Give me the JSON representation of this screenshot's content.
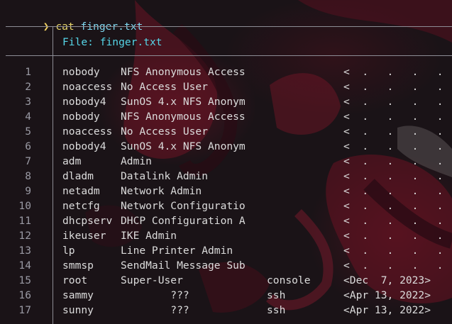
{
  "prompt": {
    "arrow": "❯",
    "command": "cat",
    "argument": "finger.txt"
  },
  "file_header": "File: finger.txt",
  "rows": [
    {
      "line": "1",
      "user": "nobody",
      "name": "NFS Anonymous Access",
      "tty": "",
      "since": "<  .   .   .   .   . >"
    },
    {
      "line": "2",
      "user": "noaccess",
      "name": "No Access User",
      "tty": "",
      "since": "<  .   .   .   .   . >"
    },
    {
      "line": "3",
      "user": "nobody4",
      "name": "SunOS 4.x NFS Anonym",
      "tty": "",
      "since": "<  .   .   .   .   . >"
    },
    {
      "line": "4",
      "user": "nobody",
      "name": "NFS Anonymous Access",
      "tty": "",
      "since": "<  .   .   .   .   . >"
    },
    {
      "line": "5",
      "user": "noaccess",
      "name": "No Access User",
      "tty": "",
      "since": "<  .   .   .   .   . >"
    },
    {
      "line": "6",
      "user": "nobody4",
      "name": "SunOS 4.x NFS Anonym",
      "tty": "",
      "since": "<  .   .   .   .   . >"
    },
    {
      "line": "7",
      "user": "adm",
      "name": "Admin",
      "tty": "",
      "since": "<  .   .   .   .   . >"
    },
    {
      "line": "8",
      "user": "dladm",
      "name": "Datalink Admin",
      "tty": "",
      "since": "<  .   .   .   .   . >"
    },
    {
      "line": "9",
      "user": "netadm",
      "name": "Network Admin",
      "tty": "",
      "since": "<  .   .   .   .   . >"
    },
    {
      "line": "10",
      "user": "netcfg",
      "name": "Network Configuratio",
      "tty": "",
      "since": "<  .   .   .   .   . >"
    },
    {
      "line": "11",
      "user": "dhcpserv",
      "name": "DHCP Configuration A",
      "tty": "",
      "since": "<  .   .   .   .   . >"
    },
    {
      "line": "12",
      "user": "ikeuser",
      "name": "IKE Admin",
      "tty": "",
      "since": "<  .   .   .   .   . >"
    },
    {
      "line": "13",
      "user": "lp",
      "name": "Line Printer Admin",
      "tty": "",
      "since": "<  .   .   .   .   . >"
    },
    {
      "line": "14",
      "user": "smmsp",
      "name": "SendMail Message Sub",
      "tty": "",
      "since": "<  .   .   .   .   . >"
    },
    {
      "line": "15",
      "user": "root",
      "name": "Super-User",
      "tty": "console",
      "since": "<Dec  7, 2023>"
    },
    {
      "line": "16",
      "user": "sammy",
      "name": "        ???",
      "tty": "ssh",
      "since": "<Apr 13, 2022>"
    },
    {
      "line": "17",
      "user": "sunny",
      "name": "        ???",
      "tty": "ssh",
      "since": "<Apr 13, 2022>"
    }
  ]
}
